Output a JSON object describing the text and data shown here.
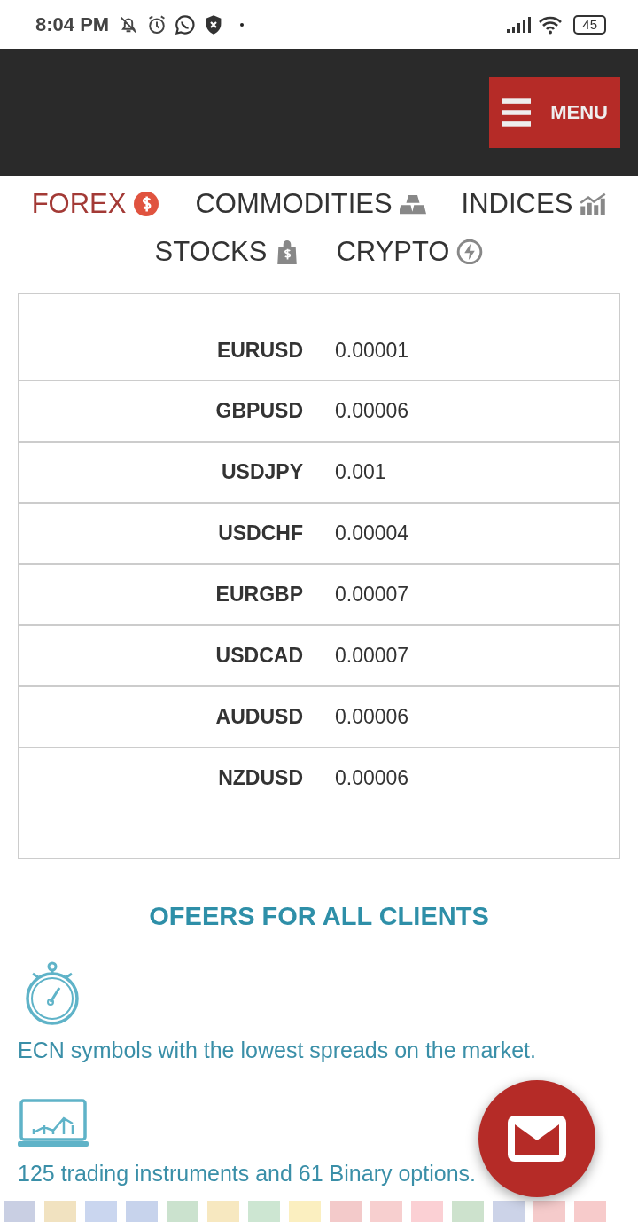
{
  "status_bar": {
    "time": "8:04 PM",
    "battery": "45"
  },
  "header": {
    "menu_label": "MENU"
  },
  "tabs": [
    {
      "label": "FOREX",
      "selected": true,
      "kind": "dollar"
    },
    {
      "label": "COMMODITIES",
      "selected": false,
      "kind": "bars"
    },
    {
      "label": "INDICES",
      "selected": false,
      "kind": "chart"
    },
    {
      "label": "STOCKS",
      "selected": false,
      "kind": "bag"
    },
    {
      "label": "CRYPTO",
      "selected": false,
      "kind": "bolt"
    }
  ],
  "table": {
    "rows": [
      {
        "symbol": "EURUSD",
        "spread": "0.00001"
      },
      {
        "symbol": "GBPUSD",
        "spread": "0.00006"
      },
      {
        "symbol": "USDJPY",
        "spread": "0.001"
      },
      {
        "symbol": "USDCHF",
        "spread": "0.00004"
      },
      {
        "symbol": "EURGBP",
        "spread": "0.00007"
      },
      {
        "symbol": "USDCAD",
        "spread": "0.00007"
      },
      {
        "symbol": "AUDUSD",
        "spread": "0.00006"
      },
      {
        "symbol": "NZDUSD",
        "spread": "0.00006"
      }
    ]
  },
  "offers": {
    "title": "OFEERS FOR ALL CLIENTS",
    "items": [
      {
        "kind": "stopwatch",
        "text": "ECN symbols with the lowest spreads on the market."
      },
      {
        "kind": "laptop",
        "text": "125 trading instruments and 61 Binary options."
      }
    ]
  },
  "flags": [
    {
      "color": "#c9cfe3"
    },
    {
      "color": "#f1e2c0"
    },
    {
      "color": "#cad6ef"
    },
    {
      "color": "#c7d3ec"
    },
    {
      "color": "#cbe2ce"
    },
    {
      "color": "#f7e8c0"
    },
    {
      "color": "#cde6d2"
    },
    {
      "color": "#fbefc0"
    },
    {
      "color": "#f3caca"
    },
    {
      "color": "#f7cfcf"
    },
    {
      "color": "#fbd0d4"
    },
    {
      "color": "#cde2cd"
    },
    {
      "color": "#ccd3e8"
    },
    {
      "color": "#f5cbcb"
    },
    {
      "color": "#f7cbcb"
    }
  ]
}
